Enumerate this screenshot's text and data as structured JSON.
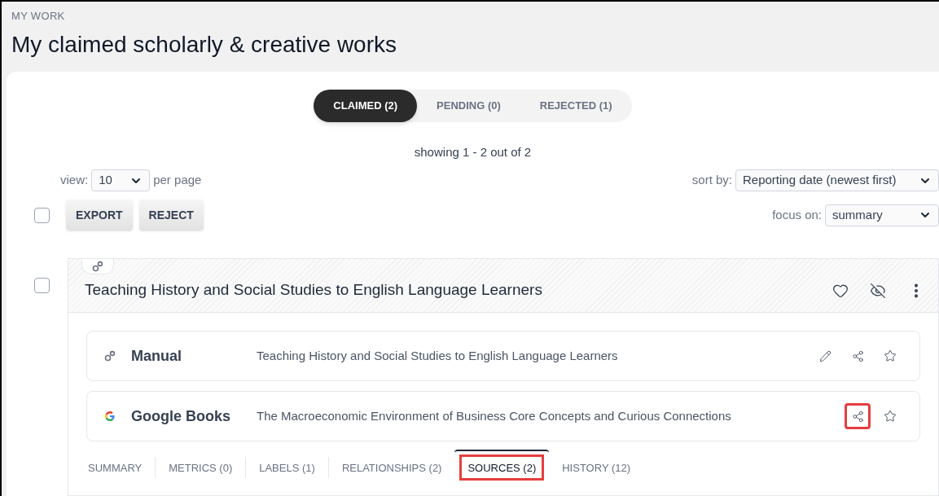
{
  "breadcrumb": "MY WORK",
  "title": "My claimed scholarly & creative works",
  "status_tabs": [
    {
      "label": "CLAIMED (2)",
      "selected": true
    },
    {
      "label": "PENDING (0)",
      "selected": false
    },
    {
      "label": "REJECTED (1)",
      "selected": false
    }
  ],
  "showing": "showing 1 - 2 out of 2",
  "view": {
    "label": "view:",
    "value": "10",
    "suffix": "per page"
  },
  "sort": {
    "label": "sort by:",
    "value": "Reporting date (newest first)"
  },
  "focus": {
    "label": "focus on:",
    "value": "summary"
  },
  "select_all": {
    "checked": false
  },
  "bulk_buttons": [
    "EXPORT",
    "REJECT"
  ],
  "work": {
    "title": "Teaching History and Social Studies to English Language Learners",
    "checked": false,
    "sources": [
      {
        "kind": "manual",
        "name": "Manual",
        "title": "Teaching History and Social Studies to English Language Learners",
        "actions": [
          {
            "kind": "edit",
            "highlighted": false
          },
          {
            "kind": "share",
            "highlighted": false
          },
          {
            "kind": "star",
            "highlighted": false
          }
        ]
      },
      {
        "kind": "google",
        "name": "Google Books",
        "title": "The Macroeconomic Environment of Business Core Concepts and Curious Connections",
        "actions": [
          {
            "kind": "share",
            "highlighted": true
          },
          {
            "kind": "star",
            "highlighted": false
          }
        ]
      }
    ],
    "tabs": [
      {
        "label": "SUMMARY",
        "selected": false,
        "highlighted": false
      },
      {
        "label": "METRICS (0)",
        "selected": false,
        "highlighted": false
      },
      {
        "label": "LABELS (1)",
        "selected": false,
        "highlighted": false
      },
      {
        "label": "RELATIONSHIPS (2)",
        "selected": false,
        "highlighted": false
      },
      {
        "label": "SOURCES (2)",
        "selected": true,
        "highlighted": true
      },
      {
        "label": "HISTORY (12)",
        "selected": false,
        "highlighted": false
      }
    ]
  }
}
